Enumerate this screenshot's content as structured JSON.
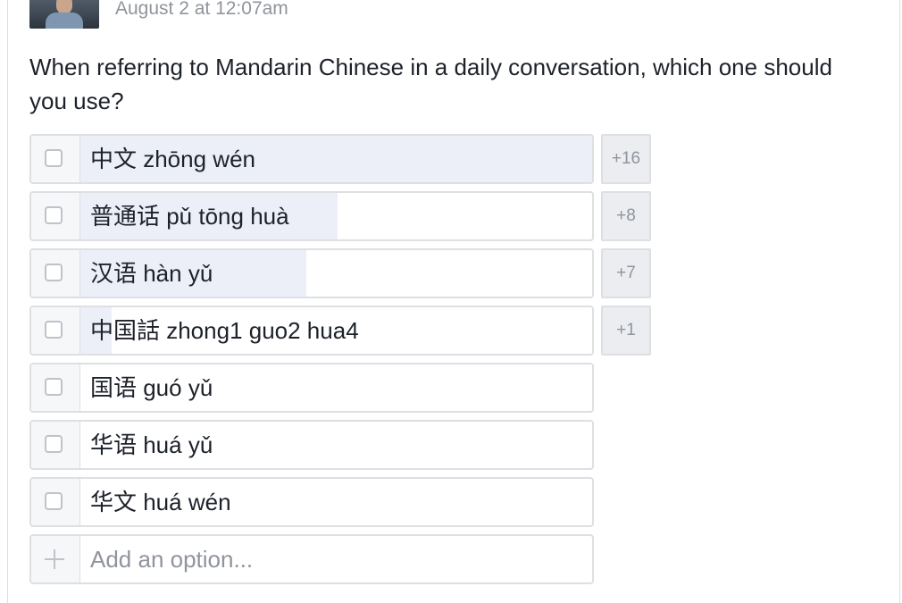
{
  "post": {
    "timestamp": "August 2 at 12:07am",
    "question": "When referring to Mandarin Chinese in a daily conversation, which one should you use?"
  },
  "poll": {
    "options": [
      {
        "label": "中文 zhōng wén",
        "votes": "+16",
        "share": 1.0
      },
      {
        "label": "普通话 pǔ tōng huà",
        "votes": "+8",
        "share": 0.5
      },
      {
        "label": "汉语 hàn yǔ",
        "votes": "+7",
        "share": 0.44
      },
      {
        "label": "中国話 zhong1 guo2 hua4",
        "votes": "+1",
        "share": 0.06
      },
      {
        "label": "国语 guó yǔ",
        "votes": "",
        "share": 0
      },
      {
        "label": "华语 huá yǔ",
        "votes": "",
        "share": 0
      },
      {
        "label": "华文 huá wén",
        "votes": "",
        "share": 0
      }
    ],
    "add_option_placeholder": "Add an option..."
  }
}
